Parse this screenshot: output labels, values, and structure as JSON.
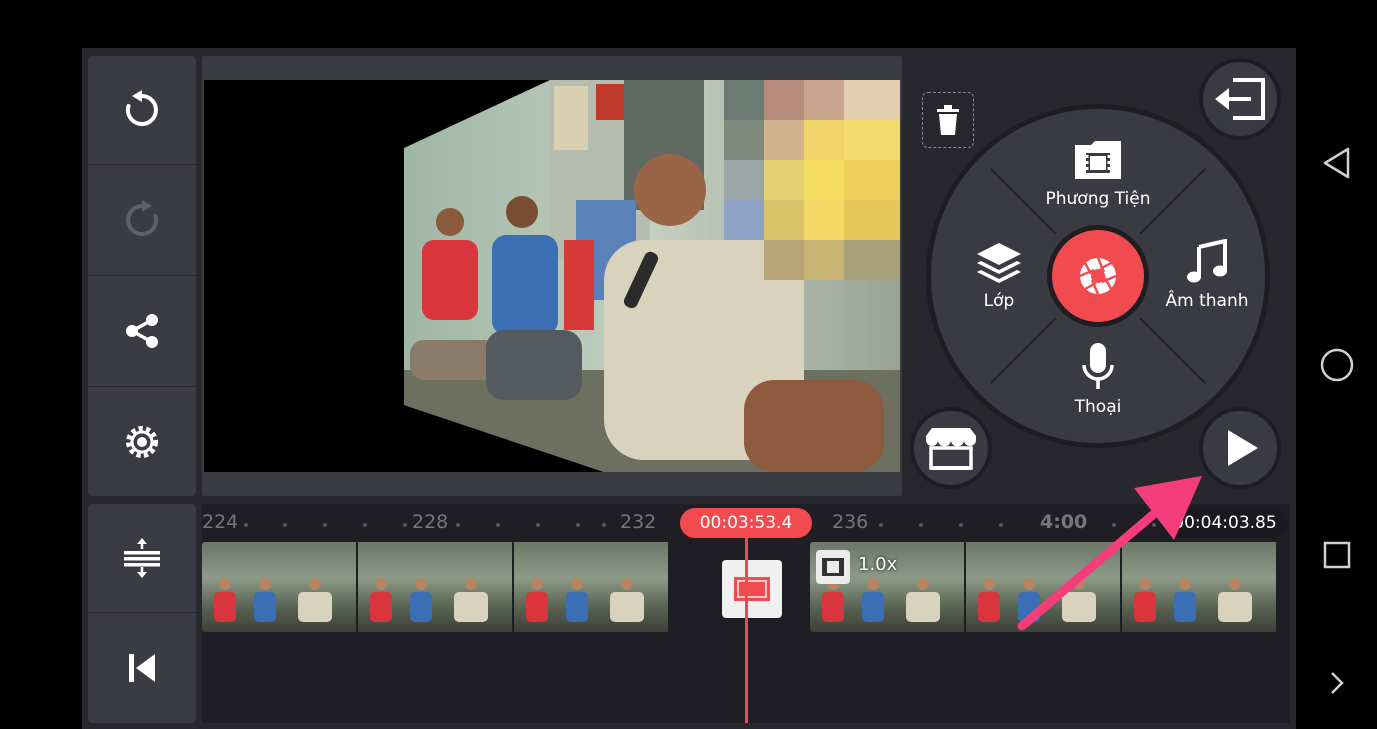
{
  "timeline": {
    "ticks": [
      "224",
      "228",
      "232",
      "236",
      "4:00"
    ],
    "playhead_time": "00:03:53.4",
    "total_time": "00:04:03.85",
    "clip_speed": "1.0x"
  },
  "media_wheel": {
    "media_label": "Phương Tiện",
    "layer_label": "Lớp",
    "audio_label": "Âm thanh",
    "voice_label": "Thoại"
  },
  "colors": {
    "accent": "#f24b4f",
    "panel": "#3b3b43",
    "background": "#27272d",
    "annotation_arrow": "#f53d7c"
  },
  "icons": {
    "undo": "undo-icon",
    "redo": "redo-icon",
    "share": "share-icon",
    "settings": "gear-icon",
    "adjust": "split-adjust-icon",
    "rewind": "skip-to-start-icon",
    "trash": "trash-icon",
    "exit": "exit-icon",
    "play": "play-icon",
    "store": "store-icon",
    "capture": "camera-shutter-icon"
  }
}
